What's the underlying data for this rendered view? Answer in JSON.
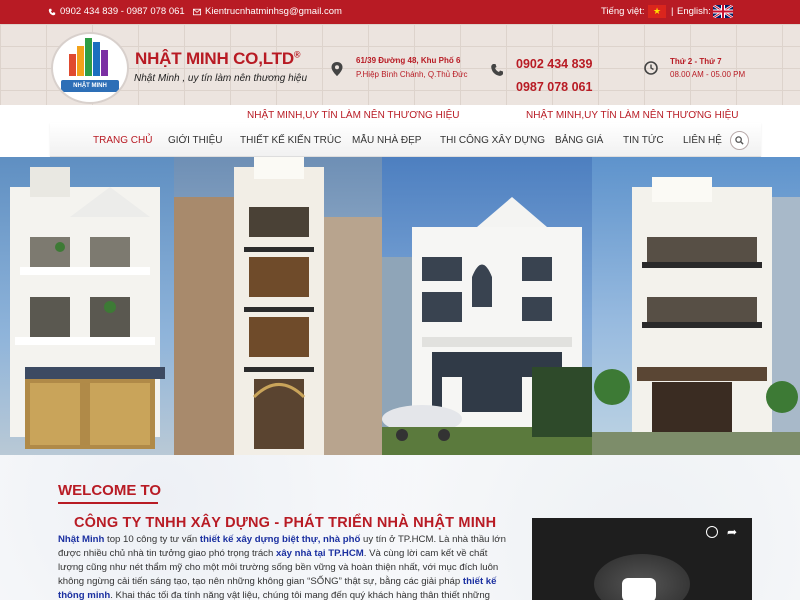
{
  "topbar": {
    "phone": "0902 434 839 - 0987 078 061",
    "email": "Kientrucnhatminhsg@gmail.com",
    "lang_vi": "Tiếng việt:",
    "lang_en": "English:",
    "separator": "|"
  },
  "header": {
    "logo_ribbon": "NHẬT MINH",
    "brand_main": "NHẬT MINH CO,LTD",
    "brand_reg": "®",
    "slogan": "Nhật Minh , uy tín làm nên thương hiệu",
    "address_line1": "61/39 Đường 48, Khu Phố 6",
    "address_line2": "P.Hiệp Bình Chánh, Q.Thủ Đức",
    "phone_line1": "0902 434 839",
    "phone_line2": "0987 078 061",
    "hours_line1": "Thứ 2 - Thứ 7",
    "hours_line2": "08.00 AM - 05.00 PM"
  },
  "tagline": {
    "left": "NHẬT MINH,UY TÍN LÀM NÊN THƯƠNG HIỆU",
    "right": "NHẬT MINH,UY TÍN LÀM NÊN THƯƠNG HIỆU"
  },
  "nav": {
    "items": [
      {
        "label": "TRANG CHỦ"
      },
      {
        "label": "GIỚI THIỆU"
      },
      {
        "label": "THIẾT KẾ KIẾN TRÚC"
      },
      {
        "label": "MẪU NHÀ ĐẸP"
      },
      {
        "label": "THI CÔNG XÂY DỰNG"
      },
      {
        "label": "BẢNG GIÁ"
      },
      {
        "label": "TIN TỨC"
      },
      {
        "label": "LIÊN HỆ"
      }
    ]
  },
  "content": {
    "welcome": "WELCOME TO",
    "company": "CÔNG TY TNHH XÂY DỰNG - PHÁT TRIỂN NHÀ NHẬT MINH",
    "p_1": "Nhật Minh",
    "p_2": " top 10 công ty tư vấn ",
    "p_3": "thiết kế xây dựng biệt thự, nhà phố",
    "p_4": " uy tín ở TP.HCM. Là nhà thầu lớn được nhiều chủ nhà tin tưởng giao phó trọng trách ",
    "p_5": "xây nhà tại TP.HCM",
    "p_6": ". Và cùng lời cam kết về chất lượng cũng như nét thẩm mỹ cho một môi trường sống bền vững và hoàn thiện nhất, với mục đích luôn không ngừng cải tiến sáng tạo, tạo nên những không gian “SỐNG” thật sự, bằng các giải pháp ",
    "p_7": "thiết kế thông minh",
    "p_8": ". Khai thác tối đa tính năng vật liệu, chúng tôi mang đến quý khách hàng thân thiết những"
  },
  "colors": {
    "brand_red": "#b81b24",
    "link_blue": "#1a2fa0"
  }
}
